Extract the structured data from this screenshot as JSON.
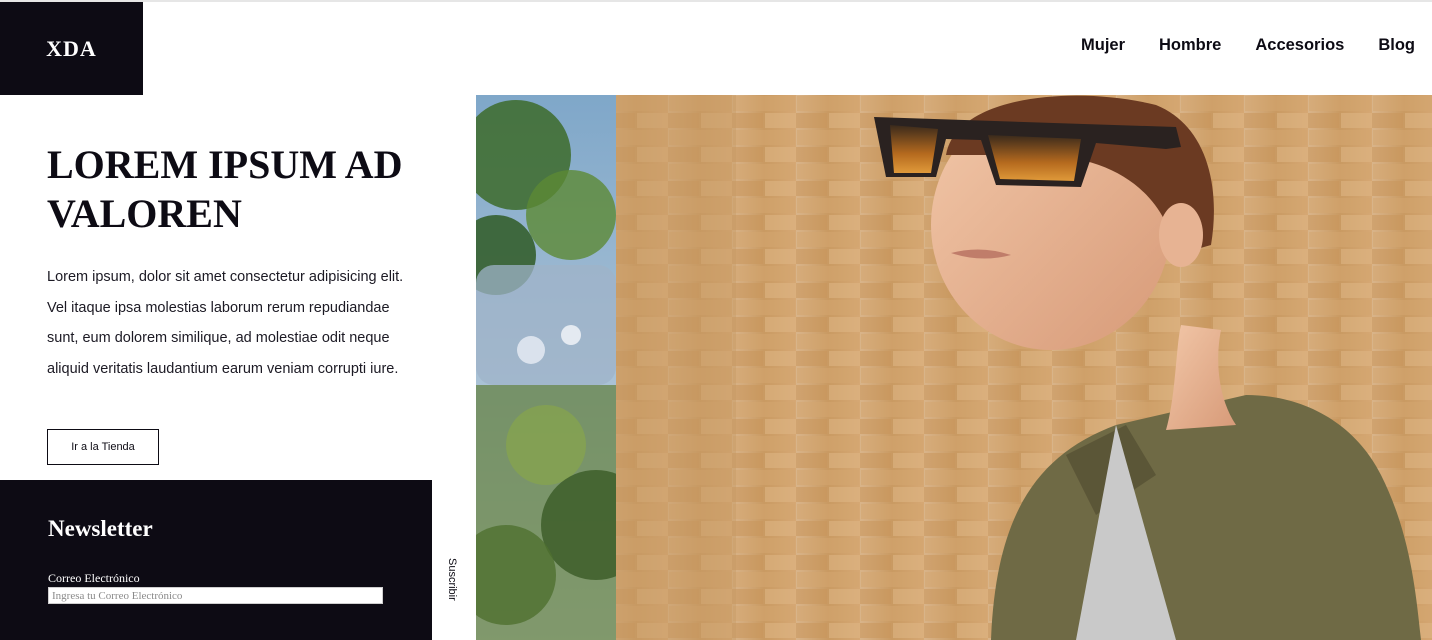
{
  "brand": {
    "logo": "XDA"
  },
  "nav": {
    "items": [
      "Mujer",
      "Hombre",
      "Accesorios",
      "Blog"
    ]
  },
  "hero": {
    "title": "LOREM IPSUM AD VALOREN",
    "body": "Lorem ipsum, dolor sit amet consectetur adipisicing elit. Vel itaque ipsa molestias laborum rerum repudiandae sunt, eum dolorem similique, ad molestiae odit neque aliquid veritatis laudantium earum veniam corrupti iure.",
    "cta": "Ir a la Tienda"
  },
  "newsletter": {
    "title": "Newsletter",
    "email_label": "Correo Electrónico",
    "email_placeholder": "Ingresa tu Correo Electrónico",
    "email_value": "",
    "submit": "Suscribir"
  },
  "colors": {
    "dark": "#0d0b14",
    "white": "#ffffff",
    "brick": "#c99a62",
    "jacket": "#6f6a45"
  }
}
